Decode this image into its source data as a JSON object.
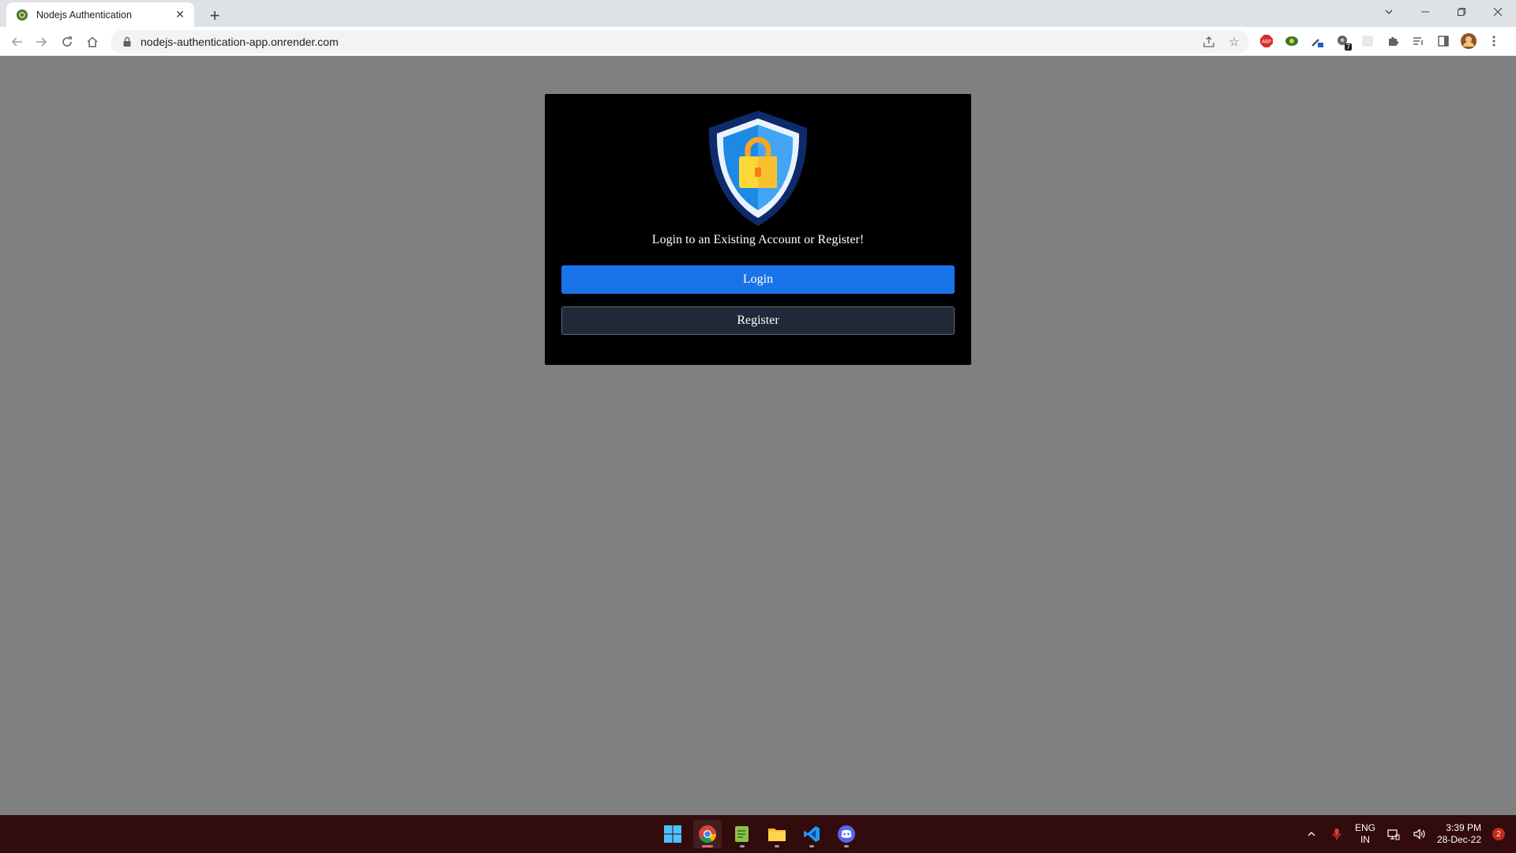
{
  "browser": {
    "tab_title": "Nodejs Authentication",
    "url": "nodejs-authentication-app.onrender.com",
    "extension_badge": "7",
    "abp_label": "ABP"
  },
  "page": {
    "prompt": "Login to an Existing Account or Register!",
    "login_label": "Login",
    "register_label": "Register",
    "colors": {
      "page_bg": "#808080",
      "card_bg": "#000000",
      "login_bg": "#1a73e8",
      "register_bg": "#1f2937"
    }
  },
  "taskbar": {
    "language": "ENG",
    "region": "IN",
    "time": "3:39 PM",
    "date": "28-Dec-22",
    "notification_count": "2",
    "apps": [
      "windows-start",
      "chrome",
      "notepad",
      "file-explorer",
      "vscode",
      "discord"
    ]
  }
}
